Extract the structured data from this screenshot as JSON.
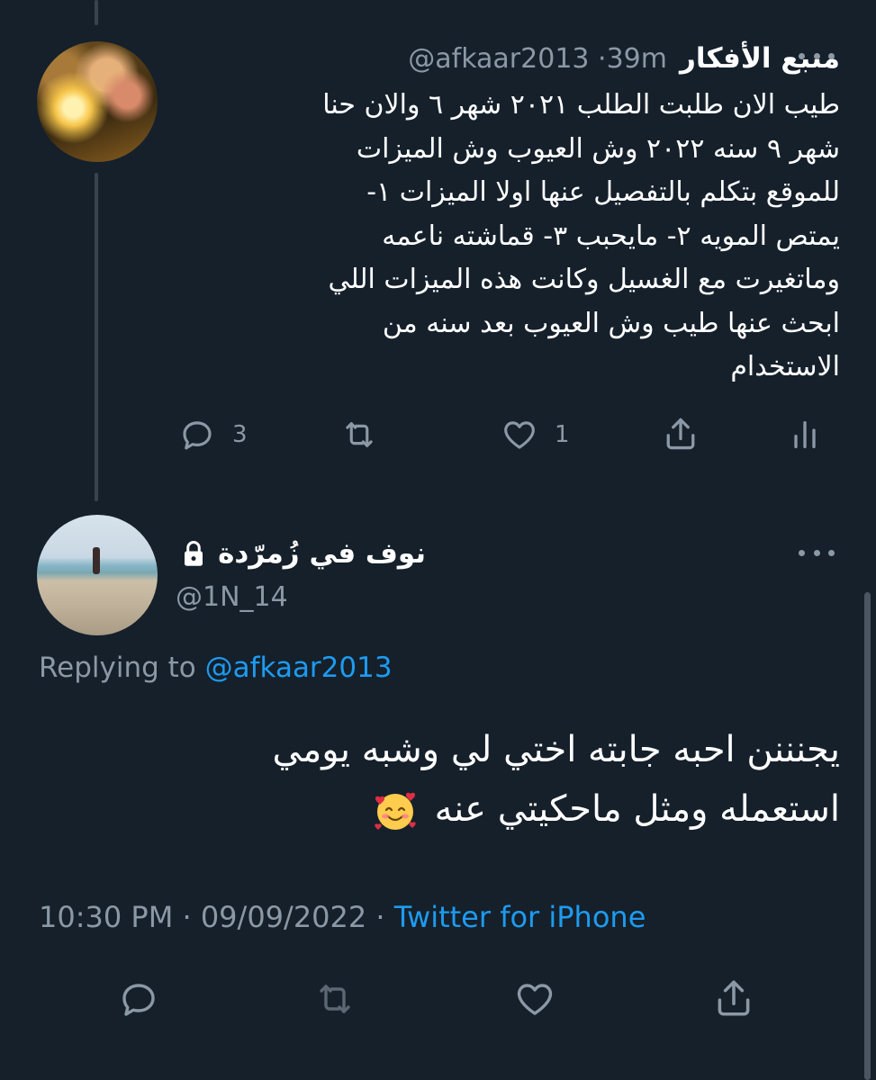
{
  "parent_tweet": {
    "display_name": "منبع الأفكار",
    "handle": "@afkaar2013",
    "separator": "·",
    "time_ago": "39m",
    "text_lines": [
      "طيب الان طلبت الطلب ٢٠٢١ شهر ٦ والان حنا",
      "شهر ٩ سنه ٢٠٢٢ وش العيوب وش الميزات",
      "للموقع بتكلم بالتفصيل عنها اولا الميزات ١-",
      "يمتص المويه ٢- مايحبب ٣- قماشته ناعمه",
      "وماتغيرت مع الغسيل وكانت هذه الميزات اللي",
      "ابحث عنها طيب وش العيوب بعد سنه من",
      "الاستخدام"
    ],
    "reply_count": "3",
    "retweet_count": "",
    "like_count": "1"
  },
  "main_tweet": {
    "display_name": "نوف في زُمرّدة",
    "handle": "@1N_14",
    "replying_prefix": "Replying to ",
    "replying_to": "@afkaar2013",
    "text_line_1": "يجنننن احبه جابته اختي لي وشبه يومي",
    "text_line_2": "استعمله ومثل ماحكيتي عنه",
    "emoji": "smiling-face-with-hearts",
    "time": "10:30 PM",
    "date": "09/09/2022",
    "dot": "·",
    "source": "Twitter for iPhone"
  },
  "icons": {
    "reply": "reply-icon",
    "retweet": "retweet-icon",
    "like": "heart-icon",
    "share": "share-icon",
    "analytics": "analytics-icon",
    "more": "more-icon",
    "lock": "lock-icon"
  },
  "colors": {
    "background": "#15202b",
    "text_primary": "#ffffff",
    "text_secondary": "#8b98a5",
    "accent": "#1d9bf0",
    "thread_line": "#38444d"
  }
}
